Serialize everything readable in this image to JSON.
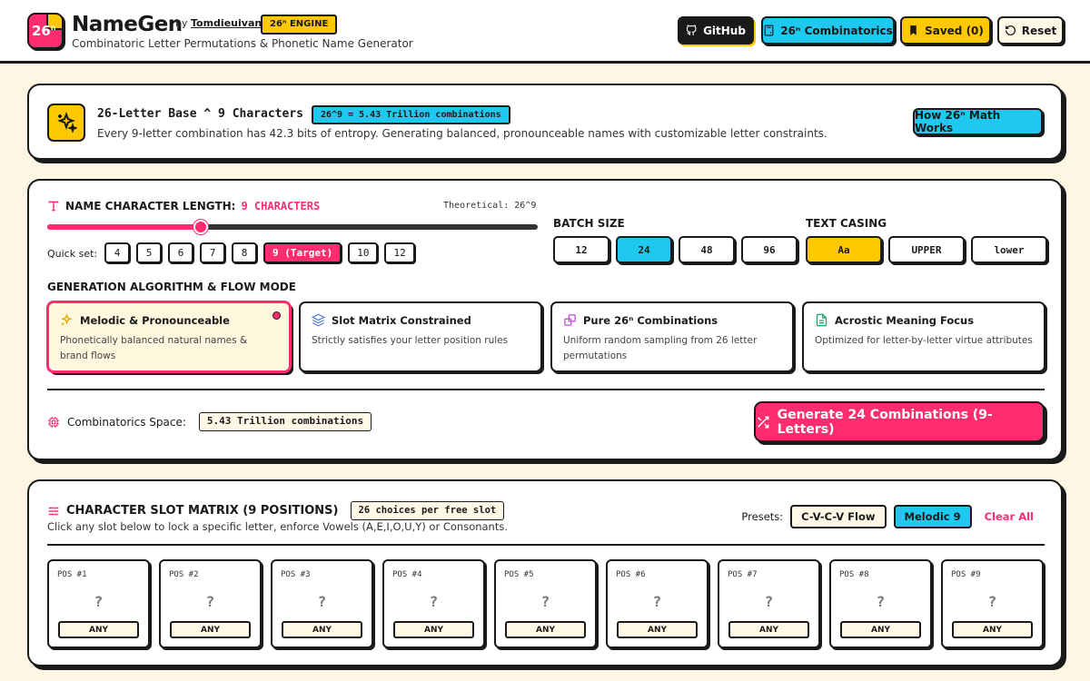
{
  "header": {
    "logo_text": "26",
    "logo_sup": "n",
    "brand": "NameGen",
    "by": "by",
    "author": "Tomdieuivan",
    "engine_badge": "26ⁿ ENGINE",
    "tagline": "Combinatoric Letter Permutations & Phonetic Name Generator",
    "buttons": {
      "github": "GitHub",
      "combinatorics": "26ⁿ Combinatorics",
      "saved": "Saved (0)",
      "reset": "Reset"
    }
  },
  "info": {
    "title": "26-Letter Base ^ 9 Characters",
    "badge": "26^9 = 5.43 Trillion combinations",
    "description": "Every 9-letter combination has 42.3 bits of entropy. Generating balanced, pronounceable names with customizable letter constraints.",
    "math_button": "How 26ⁿ Math Works"
  },
  "config": {
    "length_label": "NAME CHARACTER LENGTH:",
    "length_value": "9 CHARACTERS",
    "theoretical": "Theoretical: 26^9",
    "slider": {
      "min": 4,
      "max": 20,
      "value": 9
    },
    "quickset_label": "Quick set:",
    "quickset": [
      "4",
      "5",
      "6",
      "7",
      "8",
      "9 (Target)",
      "10",
      "12"
    ],
    "quickset_active_index": 5,
    "batch_label": "BATCH SIZE",
    "batch": [
      "12",
      "24",
      "48",
      "96"
    ],
    "batch_active_index": 1,
    "casing_label": "TEXT CASING",
    "casing": [
      "Aa",
      "UPPER",
      "lower"
    ],
    "casing_active_index": 0,
    "algo_label": "GENERATION ALGORITHM & FLOW MODE",
    "algorithms": [
      {
        "title": "Melodic & Pronounceable",
        "desc": "Phonetically balanced natural names & brand flows",
        "icon": "sparkles-icon"
      },
      {
        "title": "Slot Matrix Constrained",
        "desc": "Strictly satisfies your letter position rules",
        "icon": "layers-icon"
      },
      {
        "title": "Pure 26ⁿ Combinations",
        "desc": "Uniform random sampling from 26 letter permutations",
        "icon": "shapes-icon"
      },
      {
        "title": "Acrostic Meaning Focus",
        "desc": "Optimized for letter-by-letter virtue attributes",
        "icon": "document-icon"
      }
    ],
    "algo_active_index": 0,
    "space_label": "Combinatorics Space:",
    "space_value": "5.43 Trillion combinations",
    "generate_button": "Generate 24 Combinations (9-Letters)"
  },
  "matrix": {
    "title": "CHARACTER SLOT MATRIX (9 POSITIONS)",
    "badge": "26 choices per free slot",
    "description": "Click any slot below to lock a specific letter, enforce Vowels (A,E,I,O,U,Y) or Consonants.",
    "presets_label": "Presets:",
    "preset_cvcv": "C-V-C-V Flow",
    "preset_melodic": "Melodic 9",
    "clear": "Clear All",
    "slots": [
      {
        "pos": "POS #1",
        "value": "?",
        "mode": "ANY"
      },
      {
        "pos": "POS #2",
        "value": "?",
        "mode": "ANY"
      },
      {
        "pos": "POS #3",
        "value": "?",
        "mode": "ANY"
      },
      {
        "pos": "POS #4",
        "value": "?",
        "mode": "ANY"
      },
      {
        "pos": "POS #5",
        "value": "?",
        "mode": "ANY"
      },
      {
        "pos": "POS #6",
        "value": "?",
        "mode": "ANY"
      },
      {
        "pos": "POS #7",
        "value": "?",
        "mode": "ANY"
      },
      {
        "pos": "POS #8",
        "value": "?",
        "mode": "ANY"
      },
      {
        "pos": "POS #9",
        "value": "?",
        "mode": "ANY"
      }
    ]
  },
  "colors": {
    "pink": "#ff2d6f",
    "yellow": "#ffc800",
    "cyan": "#1ec8ee",
    "ink": "#1a1a1a",
    "cream": "#fdf6e3"
  }
}
